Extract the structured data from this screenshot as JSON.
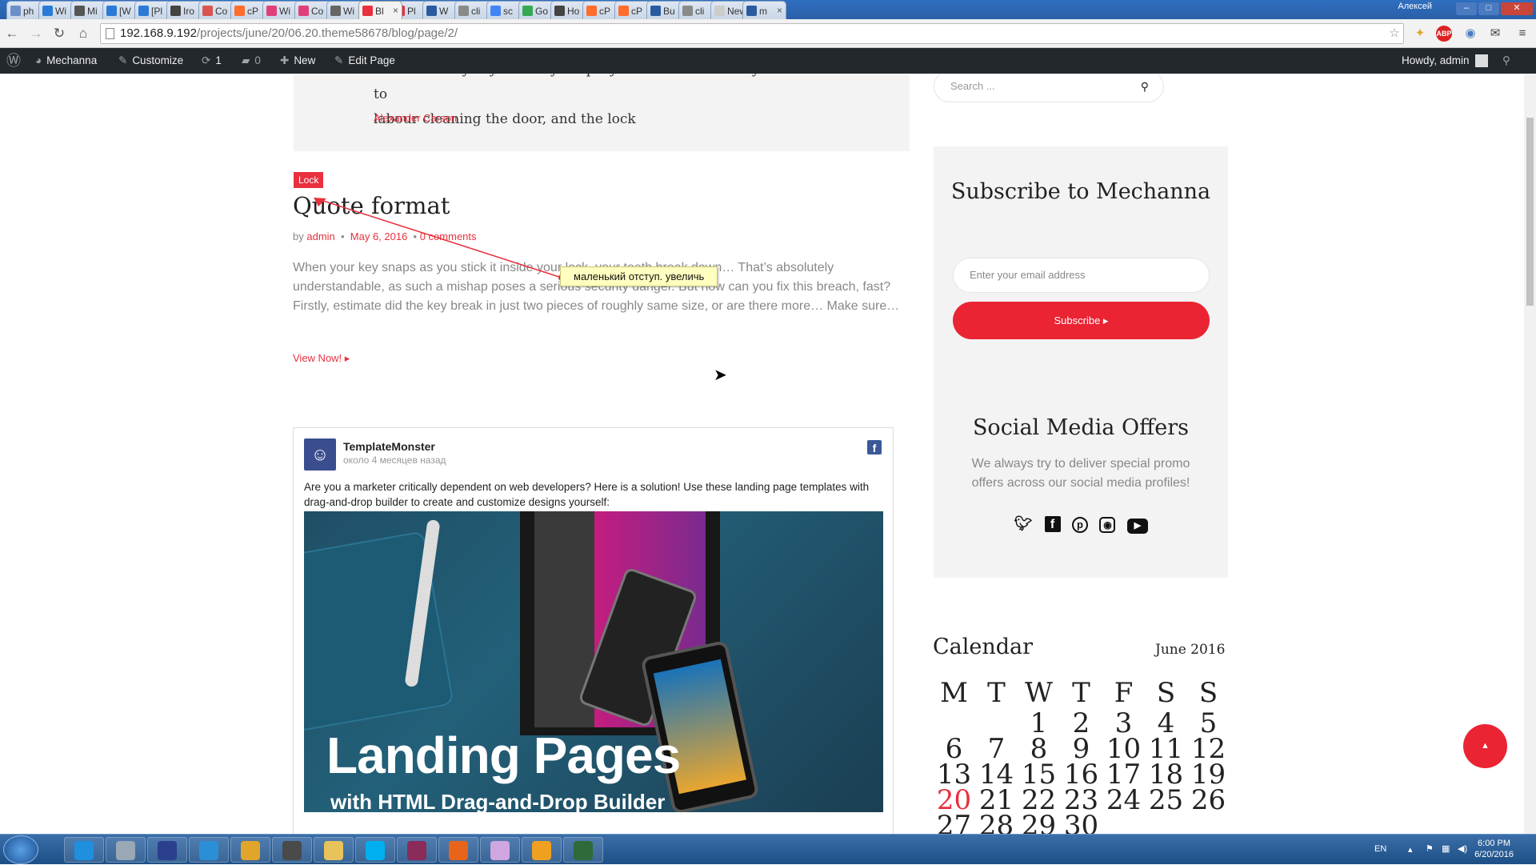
{
  "browser": {
    "tabs": [
      {
        "title": "ph",
        "color": "#6b8fc9"
      },
      {
        "title": "Wi",
        "color": "#2a7bd6"
      },
      {
        "title": "Mi",
        "color": "#555"
      },
      {
        "title": "[W",
        "color": "#2a7bd6"
      },
      {
        "title": "[Pl",
        "color": "#2a7bd6"
      },
      {
        "title": "Iro",
        "color": "#444"
      },
      {
        "title": "Co",
        "color": "#d9534f"
      },
      {
        "title": "cP",
        "color": "#ff6c2c"
      },
      {
        "title": "Wi",
        "color": "#e0407a"
      },
      {
        "title": "Co",
        "color": "#e0407a"
      },
      {
        "title": "Wi",
        "color": "#666"
      },
      {
        "title": "Bl",
        "color": "#e8303e",
        "active": true
      },
      {
        "title": "Pl",
        "color": "#e8303e"
      },
      {
        "title": "W",
        "color": "#2a5ba0"
      },
      {
        "title": "cli",
        "color": "#8a8a8a"
      },
      {
        "title": "sc",
        "color": "#4285f4"
      },
      {
        "title": "Go",
        "color": "#34a853"
      },
      {
        "title": "Ho",
        "color": "#444"
      },
      {
        "title": "cP",
        "color": "#ff6c2c"
      },
      {
        "title": "cP",
        "color": "#ff6c2c"
      },
      {
        "title": "Bu",
        "color": "#2a5ba0"
      },
      {
        "title": "cli",
        "color": "#8a8a8a"
      },
      {
        "title": "New T",
        "color": "#ccc"
      },
      {
        "title": "m",
        "color": "#2a5ba0"
      }
    ],
    "user_label": "Алексей",
    "url_host": "192.168.9.192",
    "url_path": "/projects/june/20/06.20.theme58678/blog/page/2/"
  },
  "wpbar": {
    "site_name": "Mechanna",
    "customize": "Customize",
    "updates": "1",
    "comments": "0",
    "new": "New",
    "edit": "Edit Page",
    "howdy": "Howdy, admin"
  },
  "quote": {
    "text_line1": "inside the keyway before you spray. It will ensure that you will not have to",
    "text_line2": "labour cleaning the door, and the lock",
    "author": "Alexander Carson"
  },
  "post": {
    "category": "Lock",
    "title": "Quote format",
    "by": "by",
    "author": "admin",
    "date": "May 6, 2016",
    "comments": "0 comments",
    "excerpt": "When your key snaps as you stick it inside your lock, your teeth break down… That’s absolutely understandable, as such a mishap poses a serious security danger. But how can you fix this breach, fast? Firstly, estimate did the key break in just two pieces of roughly same size, or are there more… Make sure…",
    "view_now": "View Now! ▸"
  },
  "annotation": {
    "note": "маленький отступ. увеличь"
  },
  "fb_post": {
    "page_name": "TemplateMonster",
    "time": "около 4 месяцев назад",
    "text": "Are you a marketer critically dependent on web developers? Here is a solution! Use these landing page templates with drag-and-drop builder to create and customize designs yourself:",
    "image_title": "Landing Pages",
    "image_subtitle": "with HTML Drag-and-Drop Builder"
  },
  "sidebar": {
    "search_placeholder": "Search ...",
    "subscribe_title": "Subscribe to Mechanna",
    "email_placeholder": "Enter your email address",
    "subscribe_button": "Subscribe ▸",
    "social_title": "Social Media Offers",
    "social_desc": "We always try to deliver special promo offers across our social media profiles!",
    "social_icons": [
      "twitter-icon",
      "facebook-icon",
      "pinterest-icon",
      "instagram-icon",
      "youtube-icon"
    ],
    "calendar_title": "Calendar",
    "calendar_month": "June 2016",
    "weekdays": [
      "M",
      "T",
      "W",
      "T",
      "F",
      "S",
      "S"
    ],
    "weeks": [
      [
        "",
        "",
        "1",
        "2",
        "3",
        "4",
        "5"
      ],
      [
        "6",
        "7",
        "8",
        "9",
        "10",
        "11",
        "12"
      ],
      [
        "13",
        "14",
        "15",
        "16",
        "17",
        "18",
        "19"
      ],
      [
        "20",
        "21",
        "22",
        "23",
        "24",
        "25",
        "26"
      ],
      [
        "27",
        "28",
        "29",
        "30",
        "",
        "",
        ""
      ]
    ],
    "today": "20"
  },
  "taskbar": {
    "lang": "EN",
    "time": "6:00 PM",
    "date": "6/20/2016",
    "apps": [
      {
        "name": "internet-explorer",
        "color": "#1f8fe0"
      },
      {
        "name": "calculator",
        "color": "#9aa7b5"
      },
      {
        "name": "save-app",
        "color": "#2b3f8f"
      },
      {
        "name": "skype-s",
        "color": "#2b8fd6"
      },
      {
        "name": "chrome",
        "color": "#e0a52a"
      },
      {
        "name": "sublime",
        "color": "#4a4a4a"
      },
      {
        "name": "explorer-folder",
        "color": "#e8c25a"
      },
      {
        "name": "skype",
        "color": "#00aff0"
      },
      {
        "name": "winrar",
        "color": "#8a2b5a"
      },
      {
        "name": "firefox",
        "color": "#e8641a"
      },
      {
        "name": "paint",
        "color": "#cfa6e0"
      },
      {
        "name": "photo-app",
        "color": "#f0a020"
      },
      {
        "name": "terminal",
        "color": "#2f6a3a"
      }
    ]
  },
  "colors": {
    "accent": "#e8303e",
    "wpbar": "#23282d"
  }
}
